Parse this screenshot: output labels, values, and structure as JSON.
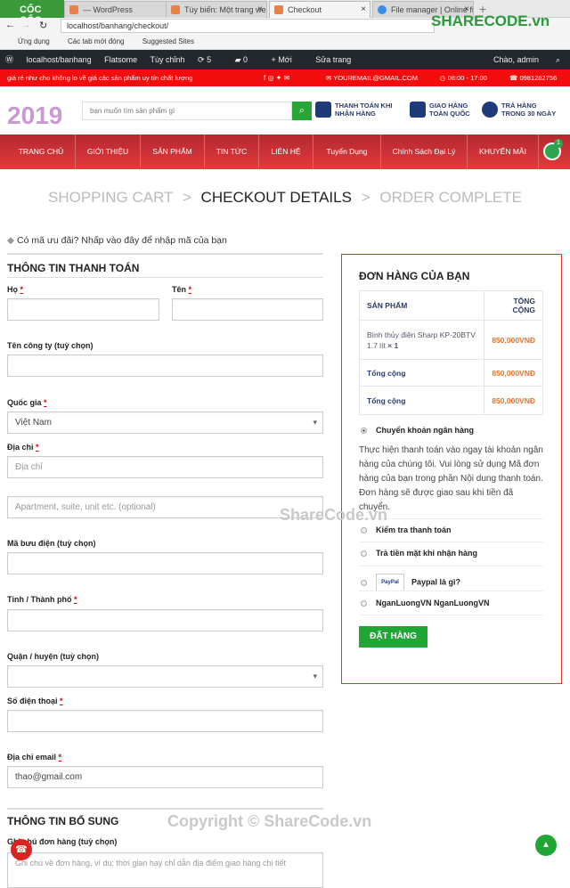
{
  "browser": {
    "brand": "CỐC CỐC",
    "tabs": [
      "— WordPress",
      "Tùy biến: Một trang web",
      "Checkout",
      "File manager | Online fi"
    ],
    "url": "localhost/banhang/checkout/",
    "bookmarks": [
      "Ứng dụng",
      "Các tab mới đóng",
      "Suggested Sites"
    ],
    "watermark": "SHARECODE.vn"
  },
  "wpbar": {
    "site": "localhost/banhang",
    "theme": "Flatsome",
    "customize": "Tùy chỉnh",
    "updates": "5",
    "comments": "0",
    "new": "Mới",
    "edit": "Sửa trang",
    "greeting": "Chào, admin"
  },
  "topbar": {
    "slogan": "giá rẻ như cho không lo về giá các sản phẩm uy tín chất lượng",
    "email": "YOUREMAIL@GMAIL.COM",
    "hours": "08:00 - 17:00",
    "phone": "0981282756"
  },
  "header": {
    "logo": "2019",
    "search_placeholder": "bạn muốn tìm sản phẩm gì",
    "features": [
      [
        "THANH TOÁN KHI",
        "NHẬN HÀNG"
      ],
      [
        "GIAO HÀNG",
        "TOÀN QUỐC"
      ],
      [
        "TRẢ HÀNG",
        "TRONG 30 NGÀY"
      ]
    ]
  },
  "nav": {
    "items": [
      "TRANG CHỦ",
      "GIỚI THIỆU",
      "SẢN PHẨM",
      "TIN TỨC",
      "LIÊN HỆ",
      "Tuyển Dụng",
      "Chính Sách Đại Lý",
      "KHUYẾN MÃI"
    ],
    "cart_count": "1"
  },
  "steps": {
    "s1": "SHOPPING CART",
    "s2": "CHECKOUT DETAILS",
    "s3": "ORDER COMPLETE",
    "sep": ">"
  },
  "coupon": "Có mã ưu đãi? Nhấp vào đây để nhập mã của bạn",
  "billing": {
    "title": "THÔNG TIN THANH TOÁN",
    "last_name": "Họ",
    "first_name": "Tên",
    "company": "Tên công ty (tuỳ chọn)",
    "country": "Quốc gia",
    "country_value": "Việt Nam",
    "address": "Địa chỉ",
    "address_ph": "Địa chỉ",
    "address2_ph": "Apartment, suite, unit etc. (optional)",
    "postcode": "Mã bưu điện (tuỳ chọn)",
    "city": "Tỉnh / Thành phố",
    "district": "Quận / huyện (tuỳ chọn)",
    "phone": "Số điện thoại",
    "email": "Địa chỉ email",
    "email_value": "thao@gmail.com",
    "req": "*"
  },
  "extra": {
    "title": "THÔNG TIN BỔ SUNG",
    "notes": "Ghi chú đơn hàng (tuỳ chọn)",
    "notes_ph": "Ghi chú về đơn hàng, ví dụ: thời gian hay chỉ dẫn địa điểm giao hàng chi tiết"
  },
  "order": {
    "title": "ĐƠN HÀNG CỦA BẠN",
    "col_product": "SẢN PHẨM",
    "col_total": "TỔNG CỘNG",
    "item": "Bình thủy điện Sharp KP-20BTV 1.7 lít",
    "qty": "× 1",
    "item_price": "850,000VNĐ",
    "subtotal_label": "Tổng cộng",
    "subtotal": "850,000VNĐ",
    "total_label": "Tổng cộng",
    "total": "850,000VNĐ"
  },
  "payment": {
    "methods": [
      "Chuyển khoản ngân hàng",
      "Kiểm tra thanh toán",
      "Trả tiền mặt khi nhận hàng",
      "Paypal là gì?",
      "NganLuongVN NganLuongVN"
    ],
    "paypal_logo": "PayPal",
    "desc": "Thực hiện thanh toán vào ngay tài khoản ngân hàng của chúng tôi. Vui lòng sử dụng Mã đơn hàng của bạn trong phần Nội dung thanh toán. Đơn hàng sẽ được giao sau khi tiền đã chuyển.",
    "place_order": "ĐẶT HÀNG"
  },
  "watermarks": {
    "mid": "ShareCode.vn",
    "bottom": "Copyright © ShareCode.vn"
  },
  "colors": {
    "red": "#f20c0c",
    "green": "#1fa635",
    "price": "#e3742b",
    "navy": "#2a3a6a"
  }
}
